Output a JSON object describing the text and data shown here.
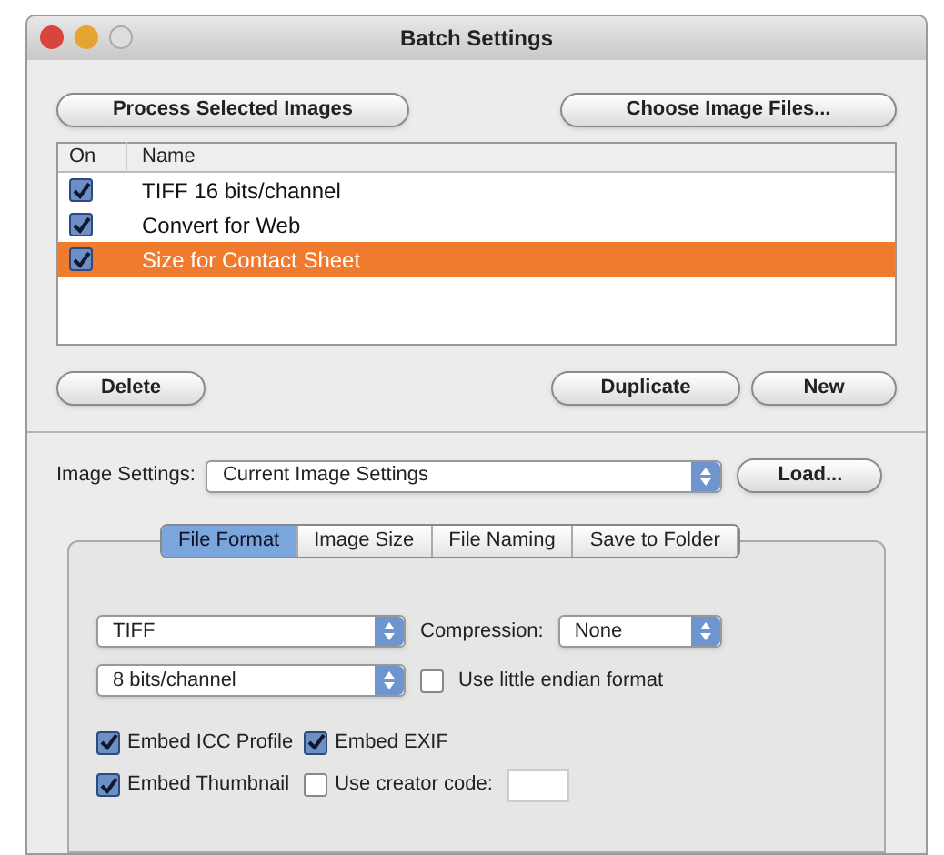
{
  "window": {
    "title": "Batch Settings"
  },
  "top_buttons": [
    "Process Selected Images",
    "Choose Image Files..."
  ],
  "list": {
    "columns": [
      "On",
      "Name"
    ],
    "rows": [
      {
        "name": "TIFF 16 bits/channel",
        "checked": true,
        "selected": false
      },
      {
        "name": "Convert for Web",
        "checked": true,
        "selected": false
      },
      {
        "name": "Size for Contact Sheet",
        "checked": true,
        "selected": true
      }
    ]
  },
  "list_buttons": [
    "Delete",
    "Duplicate",
    "New"
  ],
  "image_settings": {
    "label": "Image Settings:",
    "value": "Current Image Settings",
    "button": "Load..."
  },
  "tabs": [
    {
      "label": "File Format",
      "selected": true
    },
    {
      "label": "Image Size",
      "selected": false
    },
    {
      "label": "File Naming",
      "selected": false
    },
    {
      "label": "Save to Folder",
      "selected": false
    }
  ],
  "file_format": {
    "format": "TIFF",
    "depth": "8 bits/channel",
    "compression_label": "Compression:",
    "compression": "None",
    "little_endian": {
      "label": "Use little endian format",
      "checked": false
    },
    "checkboxes": [
      {
        "label": "Embed ICC Profile",
        "checked": true
      },
      {
        "label": "Embed EXIF",
        "checked": true
      },
      {
        "label": "Embed Thumbnail",
        "checked": true
      },
      {
        "label": "Use creator code:",
        "checked": false
      }
    ]
  }
}
